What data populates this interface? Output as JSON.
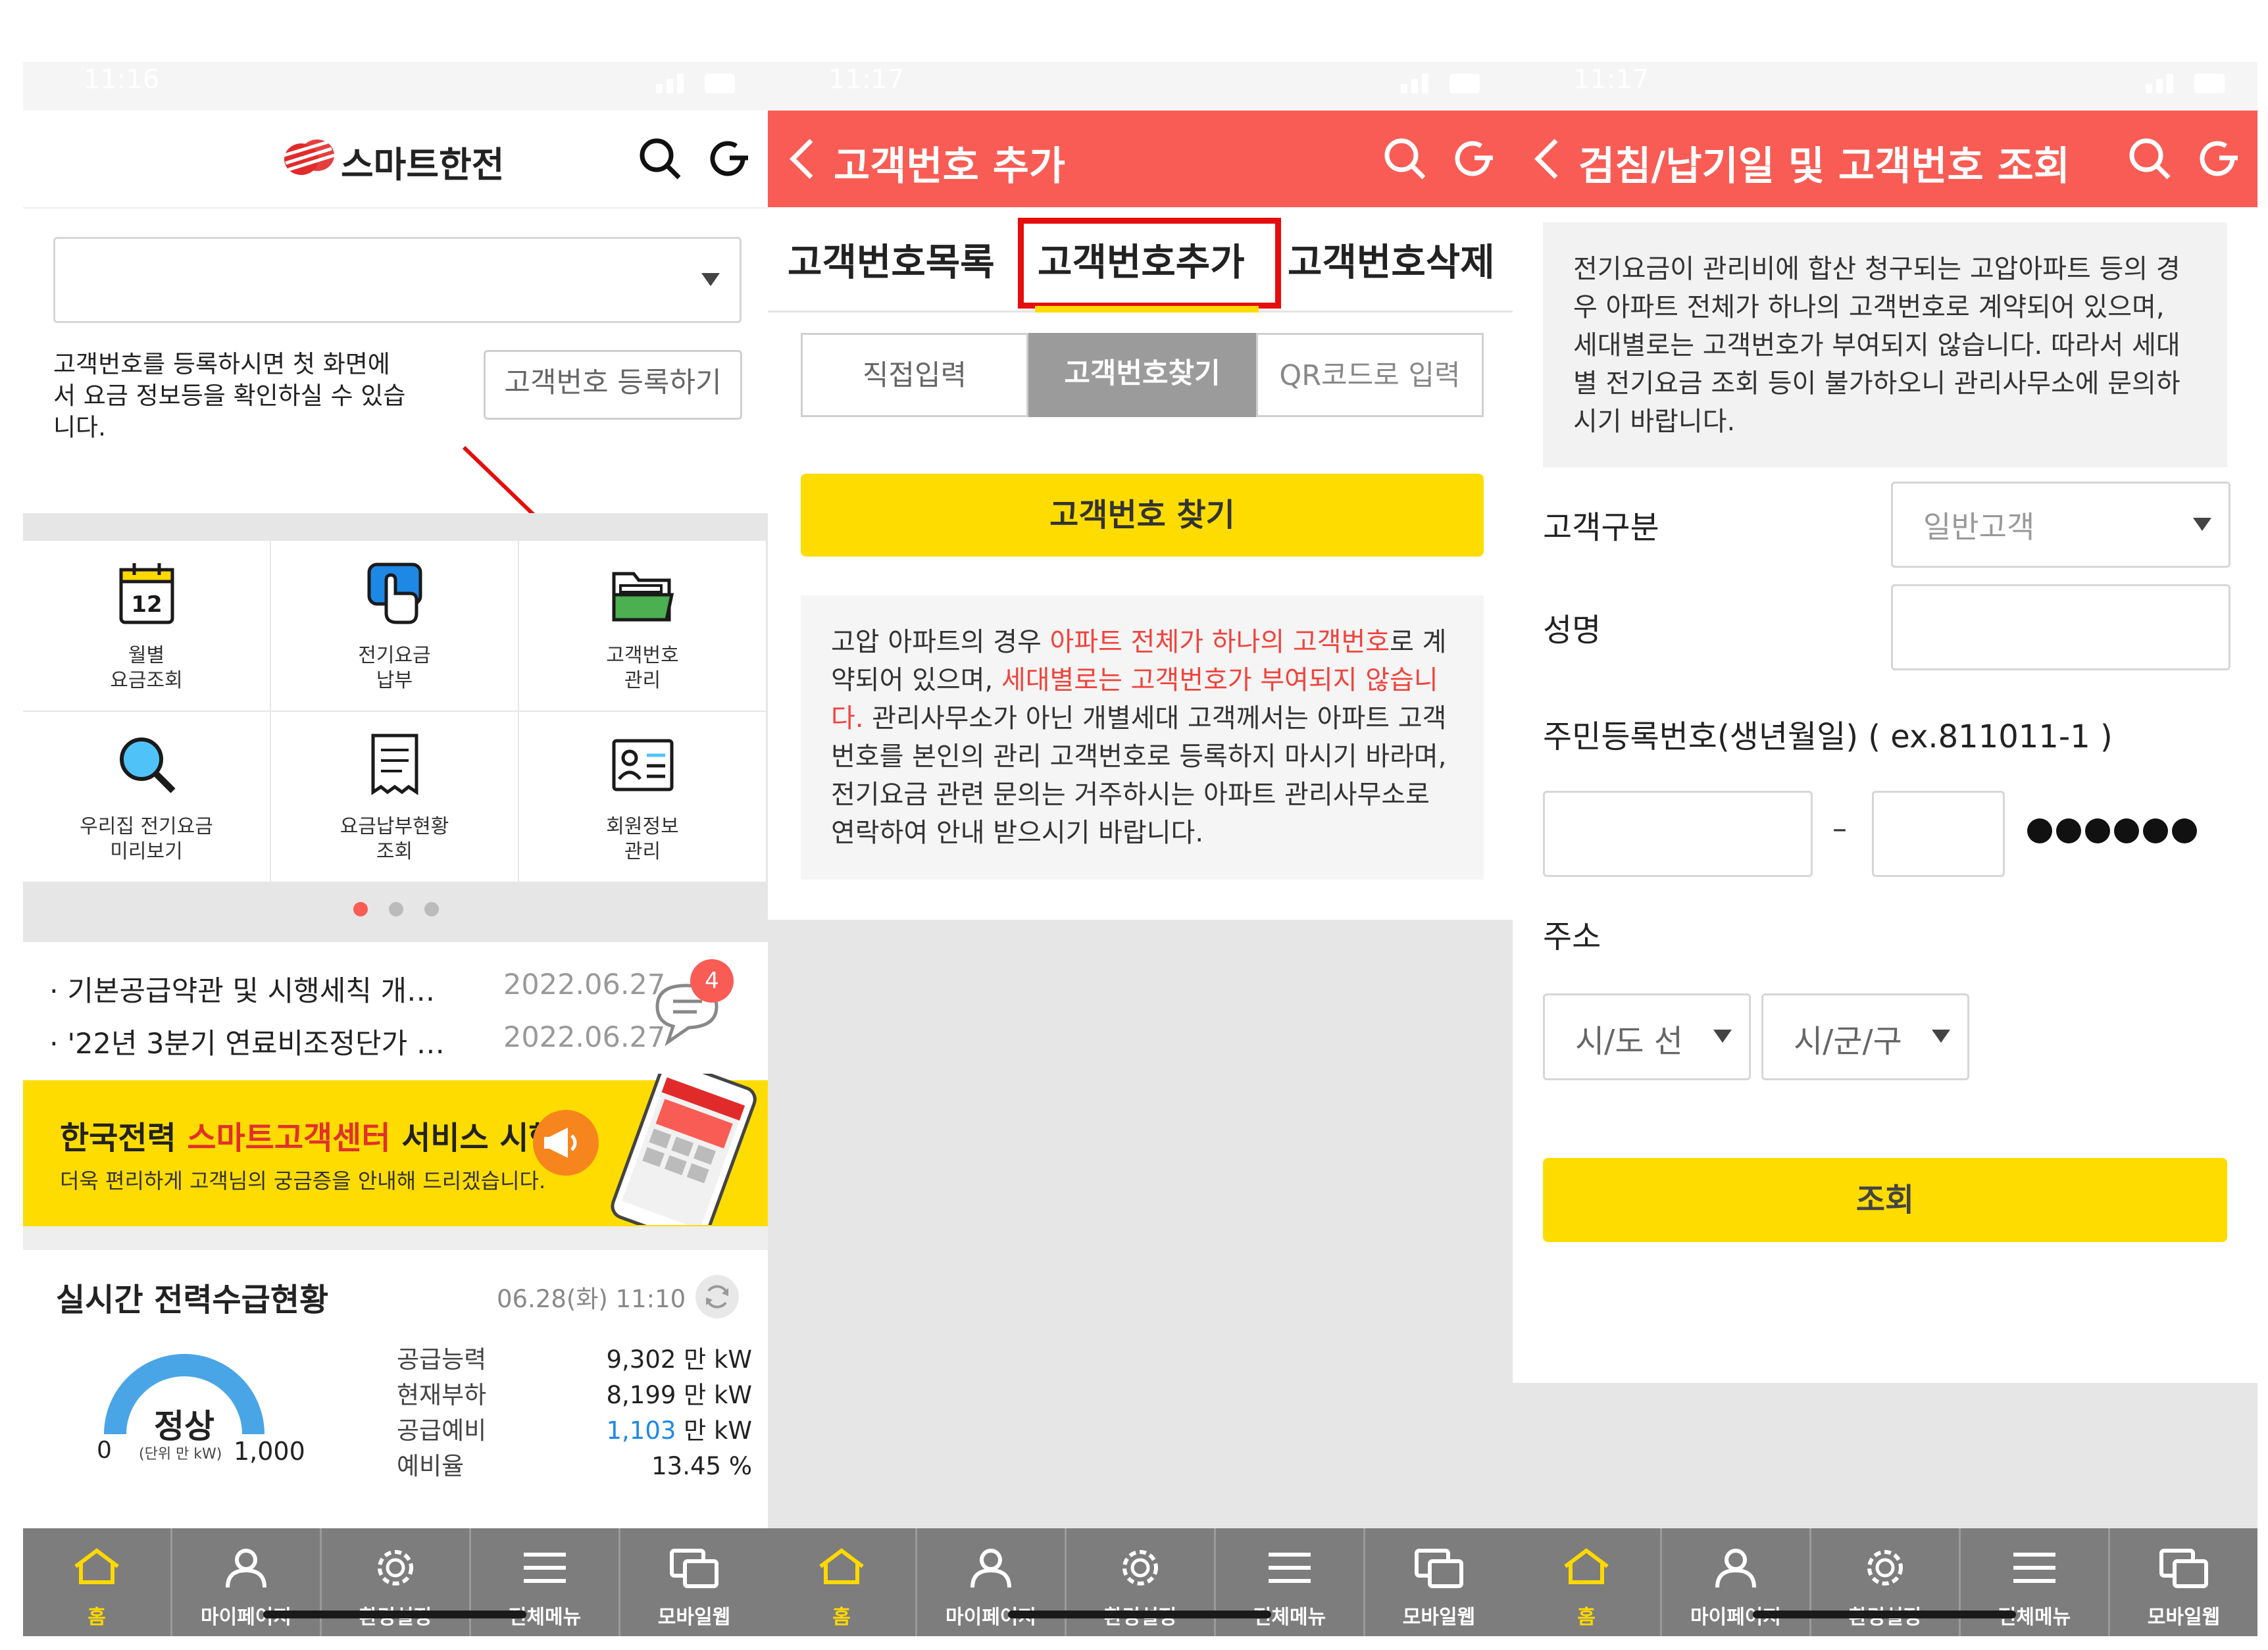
{
  "colors": {
    "accent_red": "#f95c54",
    "yellow": "#ffdc00",
    "nav_gray": "#7d7d7d",
    "highlight_red": "#e0312b",
    "blue": "#1e88e5"
  },
  "status": {
    "time1": "11:16",
    "time2": "11:17",
    "time3": "11:17"
  },
  "screen1": {
    "logo_text": "스마트한전",
    "select_value": "",
    "register_note": "고객번호를 등록하시면 첫 화면에서 요금 정보등을 확인하실 수 있습니다.",
    "register_note_l1": "고객번호를 등록하시면 첫 화면에",
    "register_note_l2": "서 요금 정보등을 확인하실 수 있습",
    "register_note_l3": "니다.",
    "register_button": "고객번호 등록하기",
    "menu": [
      {
        "icon": "calendar-icon",
        "day": "12",
        "l1": "월별",
        "l2": "요금조회"
      },
      {
        "icon": "hand-pay-icon",
        "l1": "전기요금",
        "l2": "납부"
      },
      {
        "icon": "folder-icon",
        "l1": "고객번호",
        "l2": "관리"
      },
      {
        "icon": "magnifier-icon",
        "l1": "우리집 전기요금",
        "l2": "미리보기"
      },
      {
        "icon": "receipt-icon",
        "l1": "요금납부현황",
        "l2": "조회"
      },
      {
        "icon": "member-card-icon",
        "l1": "회원정보",
        "l2": "관리"
      }
    ],
    "notices": [
      {
        "title": "기본공급약관 및 시행세칙 개…",
        "date": "2022.06.27"
      },
      {
        "title": "'22년 3분기 연료비조정단가 …",
        "date": "2022.06.27"
      }
    ],
    "chat_badge": "4",
    "banner": {
      "pre": "한국전력 ",
      "highlight": "스마트고객센터",
      "post": " 서비스 시행",
      "sub": "더욱 편리하게 고객님의 궁금증을 안내해 드리겠습니다."
    },
    "power": {
      "title": "실시간 전력수급현황",
      "datetime": "06.28(화) 11:10",
      "status": "정상",
      "gauge_min": "0",
      "gauge_unit": "(단위 만 kW)",
      "gauge_max": "1,000",
      "rows": [
        {
          "label": "공급능력",
          "value": "9,302",
          "unit": " 만 kW"
        },
        {
          "label": "현재부하",
          "value": "8,199",
          "unit": " 만 kW"
        },
        {
          "label": "공급예비",
          "value": "1,103",
          "unit": " 만 kW"
        },
        {
          "label": "예비율",
          "value": "13.45",
          "unit": " %"
        }
      ]
    }
  },
  "screen2": {
    "title": "고객번호 추가",
    "tabs": [
      "고객번호목록",
      "고객번호추가",
      "고객번호삭제"
    ],
    "segments": [
      "직접입력",
      "고객번호찾기",
      "QR코드로 입력"
    ],
    "find_button": "고객번호 찾기",
    "info": {
      "p1": "고압 아파트의 경우 ",
      "r1": "아파트 전체가 하나의 고객번호",
      "p2": "로 계약되어 있으며, ",
      "r2": "세대별로는 고객번호가 부여되지 않습니다.",
      "p3": " 관리사무소가 아닌 개별세대 고객께서는 아파트 고객번호를 본인의 관리 고객번호로 등록하지 마시기 바라며, 전기요금 관련 문의는 거주하시는 아파트 관리사무소로 연락하여 안내 받으시기 바랍니다."
    }
  },
  "screen3": {
    "title": "검침/납기일 및 고객번호 조회",
    "info": "전기요금이 관리비에 합산 청구되는 고압아파트 등의 경우 아파트 전체가 하나의 고객번호로 계약되어 있으며, 세대별로는 고객번호가 부여되지 않습니다. 따라서 세대별 전기요금 조회 등이 불가하오니 관리사무소에 문의하시기 바랍니다.",
    "customer_type_label": "고객구분",
    "customer_type_value": "일반고객",
    "name_label": "성명",
    "rrn_label": "주민등록번호(생년월일) ( ex.811011-1 )",
    "rrn_dash": "–",
    "address_label": "주소",
    "sido": "시/도 선",
    "sigungu": "시/군/구",
    "search_button": "조회"
  },
  "nav": [
    "홈",
    "마이페이지",
    "환경설정",
    "전체메뉴",
    "모바일웹"
  ]
}
